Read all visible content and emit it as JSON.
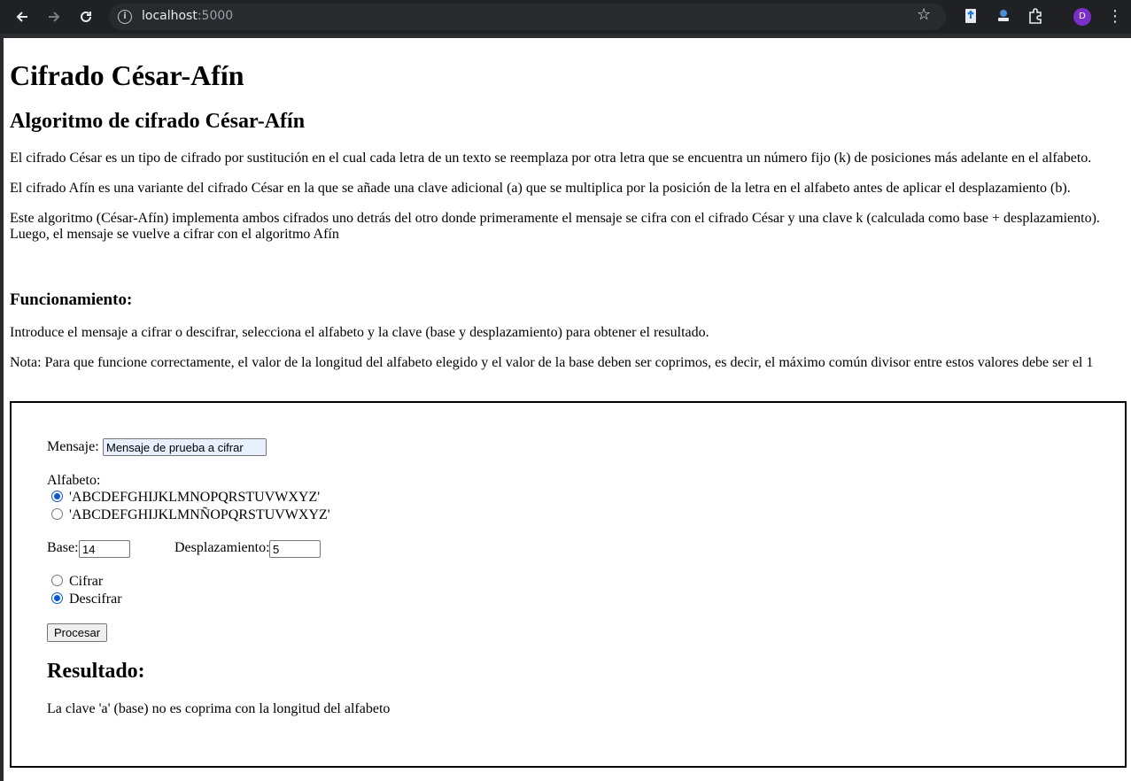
{
  "browser": {
    "url_host": "localhost",
    "url_port": ":5000",
    "avatar_letter": "D"
  },
  "page": {
    "title": "Cifrado César-Afín",
    "subtitle": "Algoritmo de cifrado César-Afín",
    "para1": "El cifrado César es un tipo de cifrado por sustitución en el cual cada letra de un texto se reemplaza por otra letra que se encuentra un número fijo (k) de posiciones más adelante en el alfabeto.",
    "para2": "El cifrado Afín es una variante del cifrado César en la que se añade una clave adicional (a) que se multiplica por la posición de la letra en el alfabeto antes de aplicar el desplazamiento (b).",
    "para3_line1": "Este algoritmo (César-Afín) implementa ambos cifrados uno detrás del otro donde primeramente el mensaje se cifra con el cifrado César y una clave k (calculada como base + desplazamiento).",
    "para3_line2": "Luego, el mensaje se vuelve a cifrar con el algoritmo Afín",
    "how_title": "Funcionamiento:",
    "how_text": "Introduce el mensaje a cifrar o descifrar, selecciona el alfabeto y la clave (base y desplazamiento) para obtener el resultado.",
    "note": "Nota: Para que funcione correctamente, el valor de la longitud del alfabeto elegido y el valor de la base deben ser coprimos, es decir, el máximo común divisor entre estos valores debe ser el 1"
  },
  "form": {
    "message_label": "Mensaje:",
    "message_value": "Mensaje de prueba a cifrar",
    "alphabet_label": "Alfabeto:",
    "alphabets": [
      {
        "label": "'ABCDEFGHIJKLMNOPQRSTUVWXYZ'",
        "selected": true
      },
      {
        "label": "'ABCDEFGHIJKLMNÑOPQRSTUVWXYZ'",
        "selected": false
      }
    ],
    "base_label": "Base:",
    "base_value": "14",
    "shift_label": "Desplazamiento:",
    "shift_value": "5",
    "modes": [
      {
        "label": "Cifrar",
        "selected": false
      },
      {
        "label": "Descifrar",
        "selected": true
      }
    ],
    "submit_label": "Procesar"
  },
  "result": {
    "title": "Resultado:",
    "text": "La clave 'a' (base) no es coprima con la longitud del alfabeto"
  },
  "colors": {
    "chrome_bg": "#202124",
    "omnibox_bg": "#282a2d",
    "radio_accent": "#0b57d0",
    "autofill_bg": "#e8f0fe"
  }
}
